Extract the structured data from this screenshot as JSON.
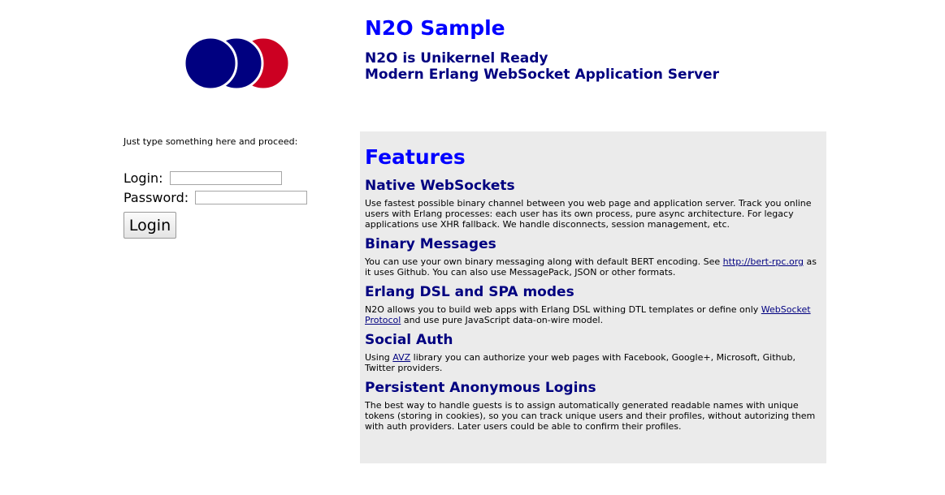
{
  "colors": {
    "title_blue": "#0000ff",
    "navy": "#000080",
    "logo_red": "#cc0022",
    "panel_bg": "#ebebeb"
  },
  "logo": {
    "icon": "n2o-circles-logo"
  },
  "header": {
    "title": "N2O Sample",
    "subtitle_line1": "N2O is Unikernel Ready",
    "subtitle_line2": "Modern Erlang WebSocket Application Server"
  },
  "login": {
    "hint": "Just type something here and proceed:",
    "login_label": "Login:",
    "login_value": "",
    "password_label": "Password:",
    "password_value": "",
    "button_label": "Login"
  },
  "features": {
    "title": "Features",
    "items": [
      {
        "heading": "Native WebSockets",
        "text": "Use fastest possible binary channel between you web page and application server. Track you online users with Erlang processes: each user has its own process, pure async architecture. For legacy applications use XHR fallback. We handle disconnects, session management, etc."
      },
      {
        "heading": "Binary Messages",
        "text_before": "You can use your own binary messaging along with default BERT encoding. See ",
        "link": "http://bert-rpc.org",
        "text_after": " as it uses Github. You can also use MessagePack, JSON or other formats."
      },
      {
        "heading": "Erlang DSL and SPA modes",
        "text_before": "N2O allows you to build web apps with Erlang DSL withing DTL templates or define only ",
        "link": "WebSocket Protocol",
        "text_after": " and use pure JavaScript data-on-wire model."
      },
      {
        "heading": "Social Auth",
        "text_before": "Using ",
        "link": "AVZ",
        "text_after": " library you can authorize your web pages with Facebook, Google+, Microsoft, Github, Twitter providers."
      },
      {
        "heading": "Persistent Anonymous Logins",
        "text": "The best way to handle guests is to assign automatically generated readable names with unique tokens (storing in cookies), so you can track unique users and their profiles, without autorizing them with auth providers. Later users could be able to confirm their profiles."
      }
    ]
  }
}
